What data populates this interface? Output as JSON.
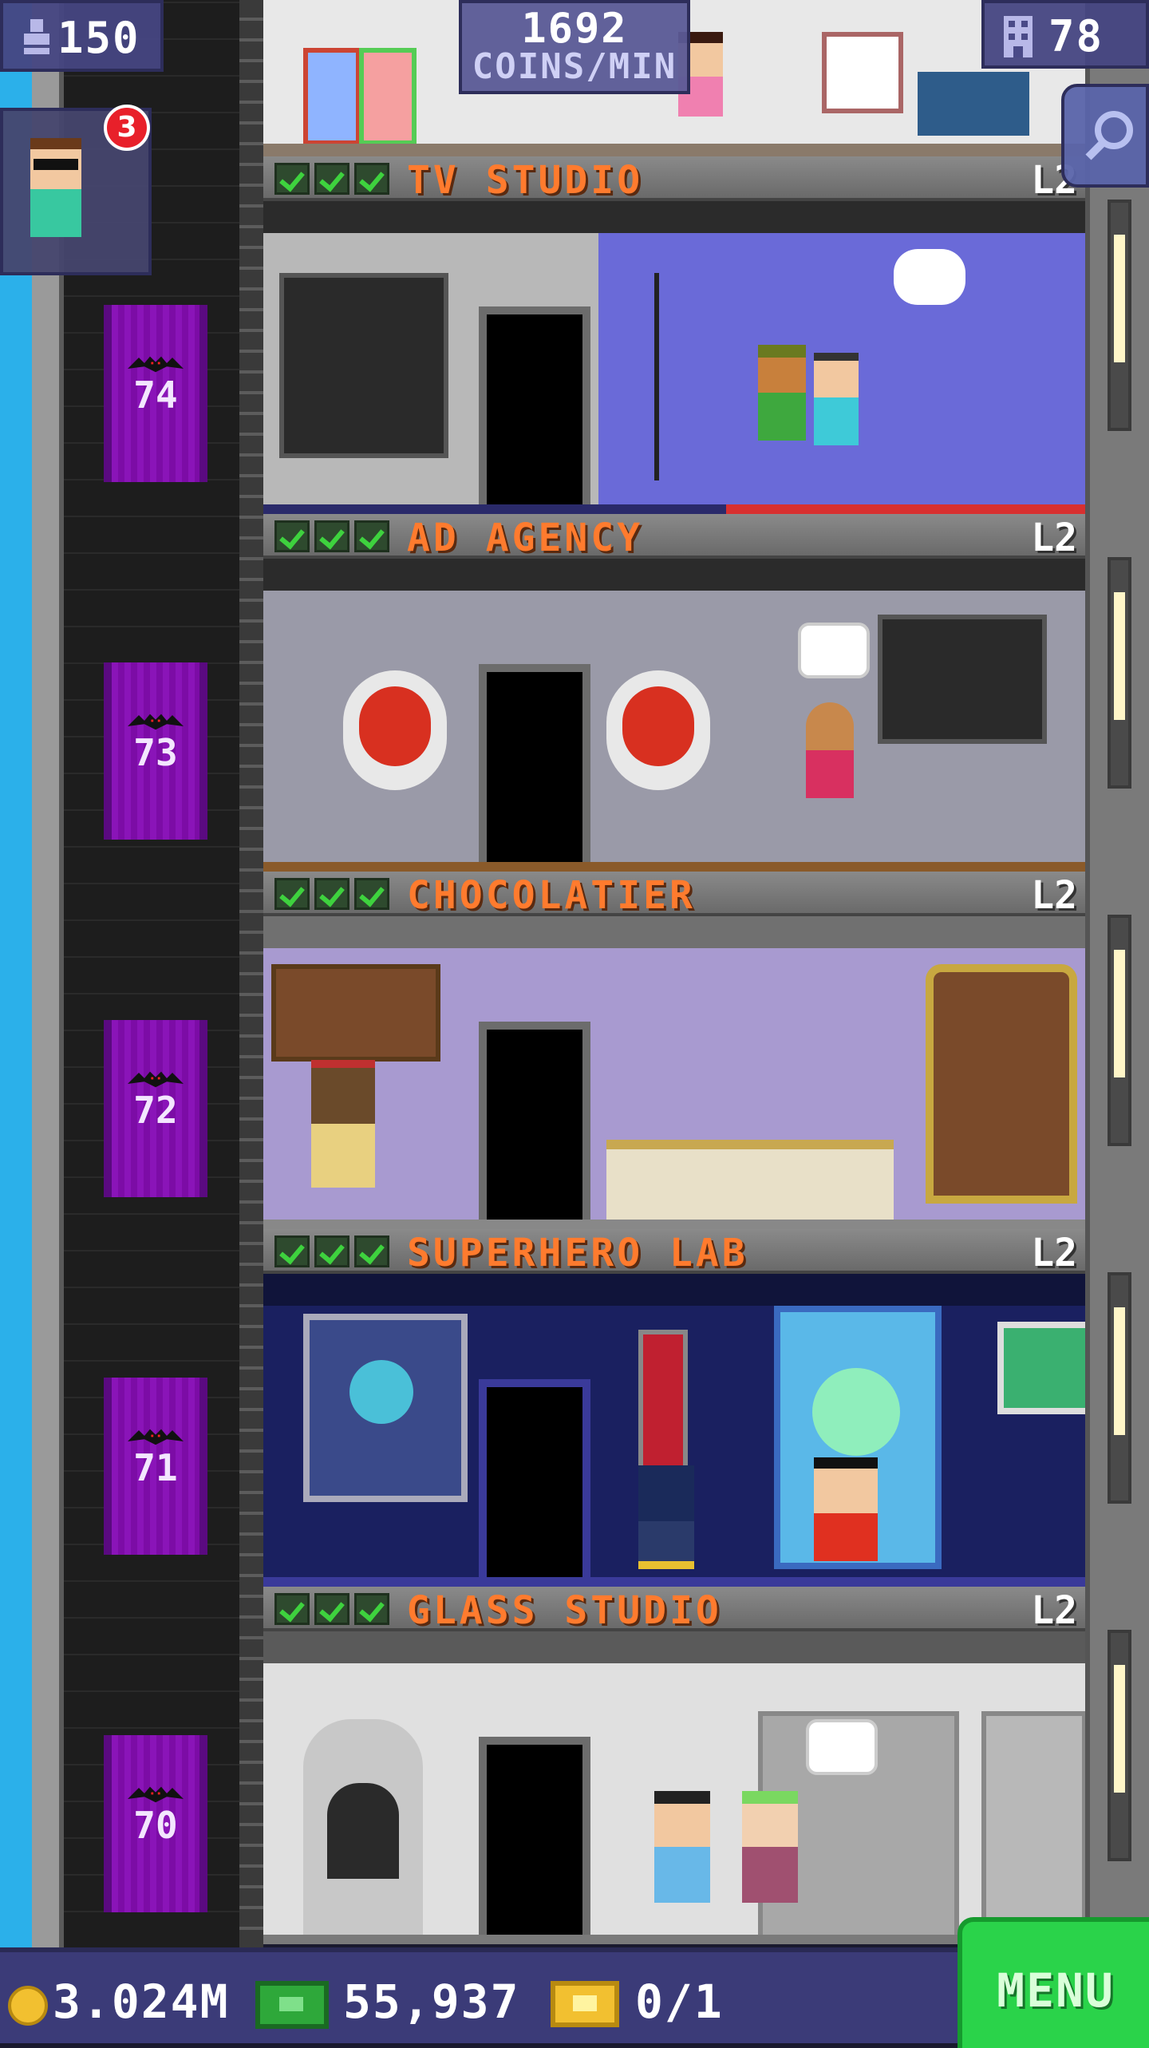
{
  "hud": {
    "population": "150",
    "coins_per_min_value": "1692",
    "coins_per_min_label": "COINS/MIN",
    "floors_count": "78",
    "visitor_badge_count": "3"
  },
  "floors": [
    {
      "name": "TV STUDIO",
      "level": "L2",
      "elevator_number": "74",
      "stars": 3
    },
    {
      "name": "AD AGENCY",
      "level": "L2",
      "elevator_number": "73",
      "stars": 3
    },
    {
      "name": "CHOCOLATIER",
      "level": "L2",
      "elevator_number": "72",
      "stars": 3
    },
    {
      "name": "SUPERHERO LAB",
      "level": "L2",
      "elevator_number": "71",
      "stars": 3
    },
    {
      "name": "GLASS STUDIO",
      "level": "L2",
      "elevator_number": "70",
      "stars": 3
    }
  ],
  "bottom_bar": {
    "coins": "3.024M",
    "bux": "55,937",
    "vip": "0/1",
    "menu_label": "MENU"
  },
  "colors": {
    "floor_name": "#ff7b2e",
    "elevator": "#7c0ca6",
    "menu": "#2ad34a",
    "check": "#3ed23e",
    "sky": "#2bb0ea"
  },
  "icons": [
    "population-icon",
    "floors-icon",
    "search-icon",
    "coin-icon",
    "bux-icon",
    "vip-ticket-icon",
    "bat-icon",
    "check-icon"
  ]
}
